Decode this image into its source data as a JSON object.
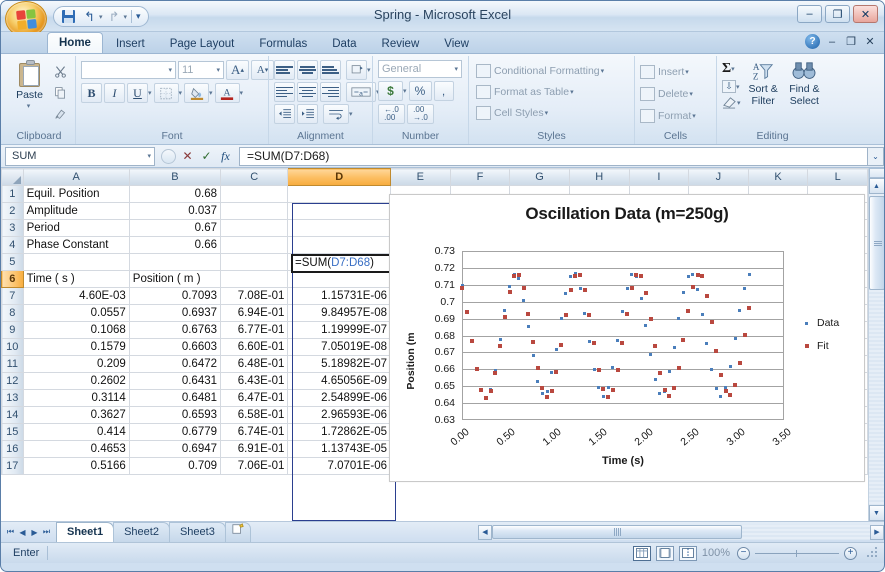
{
  "window": {
    "title": "Spring - Microsoft Excel",
    "minimize": "–",
    "maximize": "❐",
    "close": "✕"
  },
  "quick_access": {
    "save": "save-icon",
    "undo": "↰",
    "redo": "↱",
    "customize": "▾"
  },
  "ribbon": {
    "tabs": [
      {
        "label": "Home",
        "active": true
      },
      {
        "label": "Insert",
        "active": false
      },
      {
        "label": "Page Layout",
        "active": false
      },
      {
        "label": "Formulas",
        "active": false
      },
      {
        "label": "Data",
        "active": false
      },
      {
        "label": "Review",
        "active": false
      },
      {
        "label": "View",
        "active": false
      }
    ],
    "help": "?",
    "groups": {
      "clipboard": {
        "label": "Clipboard",
        "paste": "Paste",
        "paste_dropdown": "▾",
        "cut": "✂",
        "copy": "⧉",
        "format_painter": "🖌"
      },
      "font": {
        "label": "Font",
        "font_name": "",
        "font_size": "11",
        "grow_font": "A",
        "shrink_font": "A",
        "bold": "B",
        "italic": "I",
        "underline": "U",
        "borders": "▦",
        "fill_color": "A",
        "font_color": "A",
        "dropdown": "▾"
      },
      "alignment": {
        "label": "Alignment",
        "top_align": "align-top",
        "middle_align": "align-middle",
        "bottom_align": "align-bottom",
        "align_left": "align-left",
        "align_center": "align-center",
        "align_right": "align-right",
        "decrease_indent": "decrease-indent",
        "increase_indent": "increase-indent",
        "orientation": "orientation",
        "wrap_text": "wrap-text",
        "merge_center": "merge-center"
      },
      "number": {
        "label": "Number",
        "format": "General",
        "currency": "$",
        "percent": "%",
        "comma": ",",
        "increase_decimal": ".00",
        "decrease_decimal": ".00"
      },
      "styles": {
        "label": "Styles",
        "conditional_formatting": "Conditional Formatting",
        "format_as_table": "Format as Table",
        "cell_styles": "Cell Styles",
        "dropdown": "▾"
      },
      "cells": {
        "label": "Cells",
        "insert": "Insert",
        "delete": "Delete",
        "format": "Format",
        "dropdown": "▾"
      },
      "editing": {
        "label": "Editing",
        "autosum": "Σ",
        "fill": "⇩",
        "clear": "⌫",
        "sort_filter": "Sort &\nFilter",
        "sort_filter_l1": "Sort &",
        "sort_filter_l2": "Filter",
        "find_select_l1": "Find &",
        "find_select_l2": "Select",
        "dropdown": "▾"
      }
    }
  },
  "formula_bar": {
    "name_box": "SUM",
    "name_box_arrow": "▾",
    "cancel": "✕",
    "enter": "✓",
    "insert_function": "fx",
    "formula_prefix": "=SUM(",
    "formula_ref": "D7:D68",
    "formula_suffix": ")",
    "expand": "⌄"
  },
  "grid": {
    "columns": [
      "A",
      "B",
      "C",
      "D",
      "E",
      "F",
      "G",
      "H",
      "I",
      "J",
      "K",
      "L"
    ],
    "selected_column": "D",
    "selected_row": "6",
    "rows": [
      {
        "n": "1",
        "A": "Equil. Position",
        "B": "0.68",
        "C": "",
        "D": ""
      },
      {
        "n": "2",
        "A": "Amplitude",
        "B": "0.037",
        "C": "",
        "D": ""
      },
      {
        "n": "3",
        "A": "Period",
        "B": "0.67",
        "C": "",
        "D": ""
      },
      {
        "n": "4",
        "A": "Phase Constant",
        "B": "0.66",
        "C": "",
        "D": ""
      },
      {
        "n": "5",
        "A": "",
        "B": "",
        "C": "",
        "D": ""
      },
      {
        "n": "6",
        "A": "Time ( s )",
        "B": "Position ( m )",
        "C": "",
        "D": ""
      },
      {
        "n": "7",
        "A": "4.60E-03",
        "B": "0.7093",
        "C": "7.08E-01",
        "D": "1.15731E-06"
      },
      {
        "n": "8",
        "A": "0.0557",
        "B": "0.6937",
        "C": "6.94E-01",
        "D": "9.84957E-08"
      },
      {
        "n": "9",
        "A": "0.1068",
        "B": "0.6763",
        "C": "6.77E-01",
        "D": "1.19999E-07"
      },
      {
        "n": "10",
        "A": "0.1579",
        "B": "0.6603",
        "C": "6.60E-01",
        "D": "7.05019E-08"
      },
      {
        "n": "11",
        "A": "0.209",
        "B": "0.6472",
        "C": "6.48E-01",
        "D": "5.18982E-07"
      },
      {
        "n": "12",
        "A": "0.2602",
        "B": "0.6431",
        "C": "6.43E-01",
        "D": "4.65056E-09"
      },
      {
        "n": "13",
        "A": "0.3114",
        "B": "0.6481",
        "C": "6.47E-01",
        "D": "2.54899E-06"
      },
      {
        "n": "14",
        "A": "0.3627",
        "B": "0.6593",
        "C": "6.58E-01",
        "D": "2.96593E-06"
      },
      {
        "n": "15",
        "A": "0.414",
        "B": "0.6779",
        "C": "6.74E-01",
        "D": "1.72862E-05"
      },
      {
        "n": "16",
        "A": "0.4653",
        "B": "0.6947",
        "C": "6.91E-01",
        "D": "1.13743E-05"
      },
      {
        "n": "17",
        "A": "0.5166",
        "B": "0.709",
        "C": "7.06E-01",
        "D": "7.0701E-06"
      }
    ],
    "editing_cell": {
      "address": "D6",
      "prefix": "=SUM(",
      "ref": "D7:D68",
      "suffix": ")"
    }
  },
  "chart_data": {
    "type": "scatter",
    "title": "Oscillation Data (m=250g)",
    "xlabel": "Time (s)",
    "ylabel": "Position (m",
    "xlim": [
      0.0,
      3.5
    ],
    "ylim": [
      0.63,
      0.73
    ],
    "xticks": [
      "0.00",
      "0.50",
      "1.00",
      "1.50",
      "2.00",
      "2.50",
      "3.00",
      "3.50"
    ],
    "yticks": [
      "0.73",
      "0.72",
      "0.71",
      "0.7",
      "0.69",
      "0.68",
      "0.67",
      "0.66",
      "0.65",
      "0.64",
      "0.63"
    ],
    "grid": "horizontal",
    "legend_position": "right",
    "series": [
      {
        "name": "Data",
        "color": "#4a7ebb",
        "marker": "dot",
        "points": [
          [
            0.005,
            0.7093
          ],
          [
            0.056,
            0.6937
          ],
          [
            0.107,
            0.6763
          ],
          [
            0.158,
            0.6603
          ],
          [
            0.209,
            0.6472
          ],
          [
            0.26,
            0.6431
          ],
          [
            0.311,
            0.6481
          ],
          [
            0.363,
            0.6593
          ],
          [
            0.414,
            0.6779
          ],
          [
            0.465,
            0.6947
          ],
          [
            0.517,
            0.709
          ],
          [
            0.568,
            0.7158
          ],
          [
            0.619,
            0.714
          ],
          [
            0.67,
            0.701
          ],
          [
            0.721,
            0.6855
          ],
          [
            0.772,
            0.668
          ],
          [
            0.823,
            0.653
          ],
          [
            0.874,
            0.6455
          ],
          [
            0.925,
            0.647
          ],
          [
            0.976,
            0.658
          ],
          [
            1.027,
            0.672
          ],
          [
            1.078,
            0.69
          ],
          [
            1.13,
            0.705
          ],
          [
            1.181,
            0.715
          ],
          [
            1.232,
            0.7165
          ],
          [
            1.283,
            0.708
          ],
          [
            1.334,
            0.693
          ],
          [
            1.385,
            0.6765
          ],
          [
            1.436,
            0.66
          ],
          [
            1.487,
            0.649
          ],
          [
            1.538,
            0.644
          ],
          [
            1.589,
            0.649
          ],
          [
            1.64,
            0.661
          ],
          [
            1.691,
            0.677
          ],
          [
            1.743,
            0.694
          ],
          [
            1.794,
            0.708
          ],
          [
            1.845,
            0.716
          ],
          [
            1.896,
            0.715
          ],
          [
            1.947,
            0.702
          ],
          [
            1.998,
            0.686
          ],
          [
            2.049,
            0.669
          ],
          [
            2.1,
            0.654
          ],
          [
            2.151,
            0.6455
          ],
          [
            2.202,
            0.647
          ],
          [
            2.253,
            0.6585
          ],
          [
            2.305,
            0.673
          ],
          [
            2.356,
            0.69
          ],
          [
            2.407,
            0.7055
          ],
          [
            2.458,
            0.715
          ],
          [
            2.509,
            0.716
          ],
          [
            2.56,
            0.707
          ],
          [
            2.611,
            0.6925
          ],
          [
            2.662,
            0.6755
          ],
          [
            2.713,
            0.66
          ],
          [
            2.764,
            0.6487
          ],
          [
            2.815,
            0.6442
          ],
          [
            2.866,
            0.6495
          ],
          [
            2.918,
            0.6615
          ],
          [
            2.969,
            0.678
          ],
          [
            3.02,
            0.6945
          ],
          [
            3.071,
            0.708
          ],
          [
            3.122,
            0.716
          ]
        ]
      },
      {
        "name": "Fit",
        "color": "#b9483f",
        "marker": "square",
        "points": [
          [
            0.005,
            0.708
          ],
          [
            0.056,
            0.694
          ],
          [
            0.107,
            0.677
          ],
          [
            0.158,
            0.66
          ],
          [
            0.209,
            0.648
          ],
          [
            0.26,
            0.643
          ],
          [
            0.311,
            0.647
          ],
          [
            0.363,
            0.658
          ],
          [
            0.414,
            0.674
          ],
          [
            0.465,
            0.691
          ],
          [
            0.517,
            0.706
          ],
          [
            0.568,
            0.7155
          ],
          [
            0.619,
            0.716
          ],
          [
            0.67,
            0.708
          ],
          [
            0.721,
            0.693
          ],
          [
            0.772,
            0.676
          ],
          [
            0.823,
            0.6605
          ],
          [
            0.874,
            0.649
          ],
          [
            0.925,
            0.6435
          ],
          [
            0.976,
            0.647
          ],
          [
            1.027,
            0.6585
          ],
          [
            1.078,
            0.6745
          ],
          [
            1.13,
            0.692
          ],
          [
            1.181,
            0.707
          ],
          [
            1.232,
            0.7155
          ],
          [
            1.283,
            0.716
          ],
          [
            1.334,
            0.707
          ],
          [
            1.385,
            0.692
          ],
          [
            1.436,
            0.6755
          ],
          [
            1.487,
            0.6595
          ],
          [
            1.538,
            0.6485
          ],
          [
            1.589,
            0.6435
          ],
          [
            1.64,
            0.648
          ],
          [
            1.691,
            0.6595
          ],
          [
            1.743,
            0.6755
          ],
          [
            1.794,
            0.693
          ],
          [
            1.845,
            0.708
          ],
          [
            1.896,
            0.716
          ],
          [
            1.947,
            0.715
          ],
          [
            1.998,
            0.705
          ],
          [
            2.049,
            0.69
          ],
          [
            2.1,
            0.6735
          ],
          [
            2.151,
            0.658
          ],
          [
            2.202,
            0.6475
          ],
          [
            2.253,
            0.644
          ],
          [
            2.305,
            0.649
          ],
          [
            2.356,
            0.661
          ],
          [
            2.407,
            0.6775
          ],
          [
            2.458,
            0.6945
          ],
          [
            2.509,
            0.7085
          ],
          [
            2.56,
            0.716
          ],
          [
            2.611,
            0.715
          ],
          [
            2.662,
            0.7035
          ],
          [
            2.713,
            0.688
          ],
          [
            2.764,
            0.671
          ],
          [
            2.815,
            0.6565
          ],
          [
            2.866,
            0.647
          ],
          [
            2.918,
            0.6445
          ],
          [
            2.969,
            0.651
          ],
          [
            3.02,
            0.664
          ],
          [
            3.071,
            0.6805
          ],
          [
            3.122,
            0.6965
          ]
        ]
      }
    ]
  },
  "sheet_tabs": {
    "first": "⏮",
    "prev": "◀",
    "next": "▶",
    "last": "⏭",
    "tabs": [
      {
        "label": "Sheet1",
        "active": true
      },
      {
        "label": "Sheet2",
        "active": false
      },
      {
        "label": "Sheet3",
        "active": false
      }
    ],
    "new_sheet": "✨"
  },
  "status_bar": {
    "mode": "Enter",
    "zoom": "100%",
    "zoom_out": "−",
    "zoom_in": "+",
    "view_normal": "normal-view",
    "view_layout": "page-layout-view",
    "view_break": "page-break-view"
  }
}
